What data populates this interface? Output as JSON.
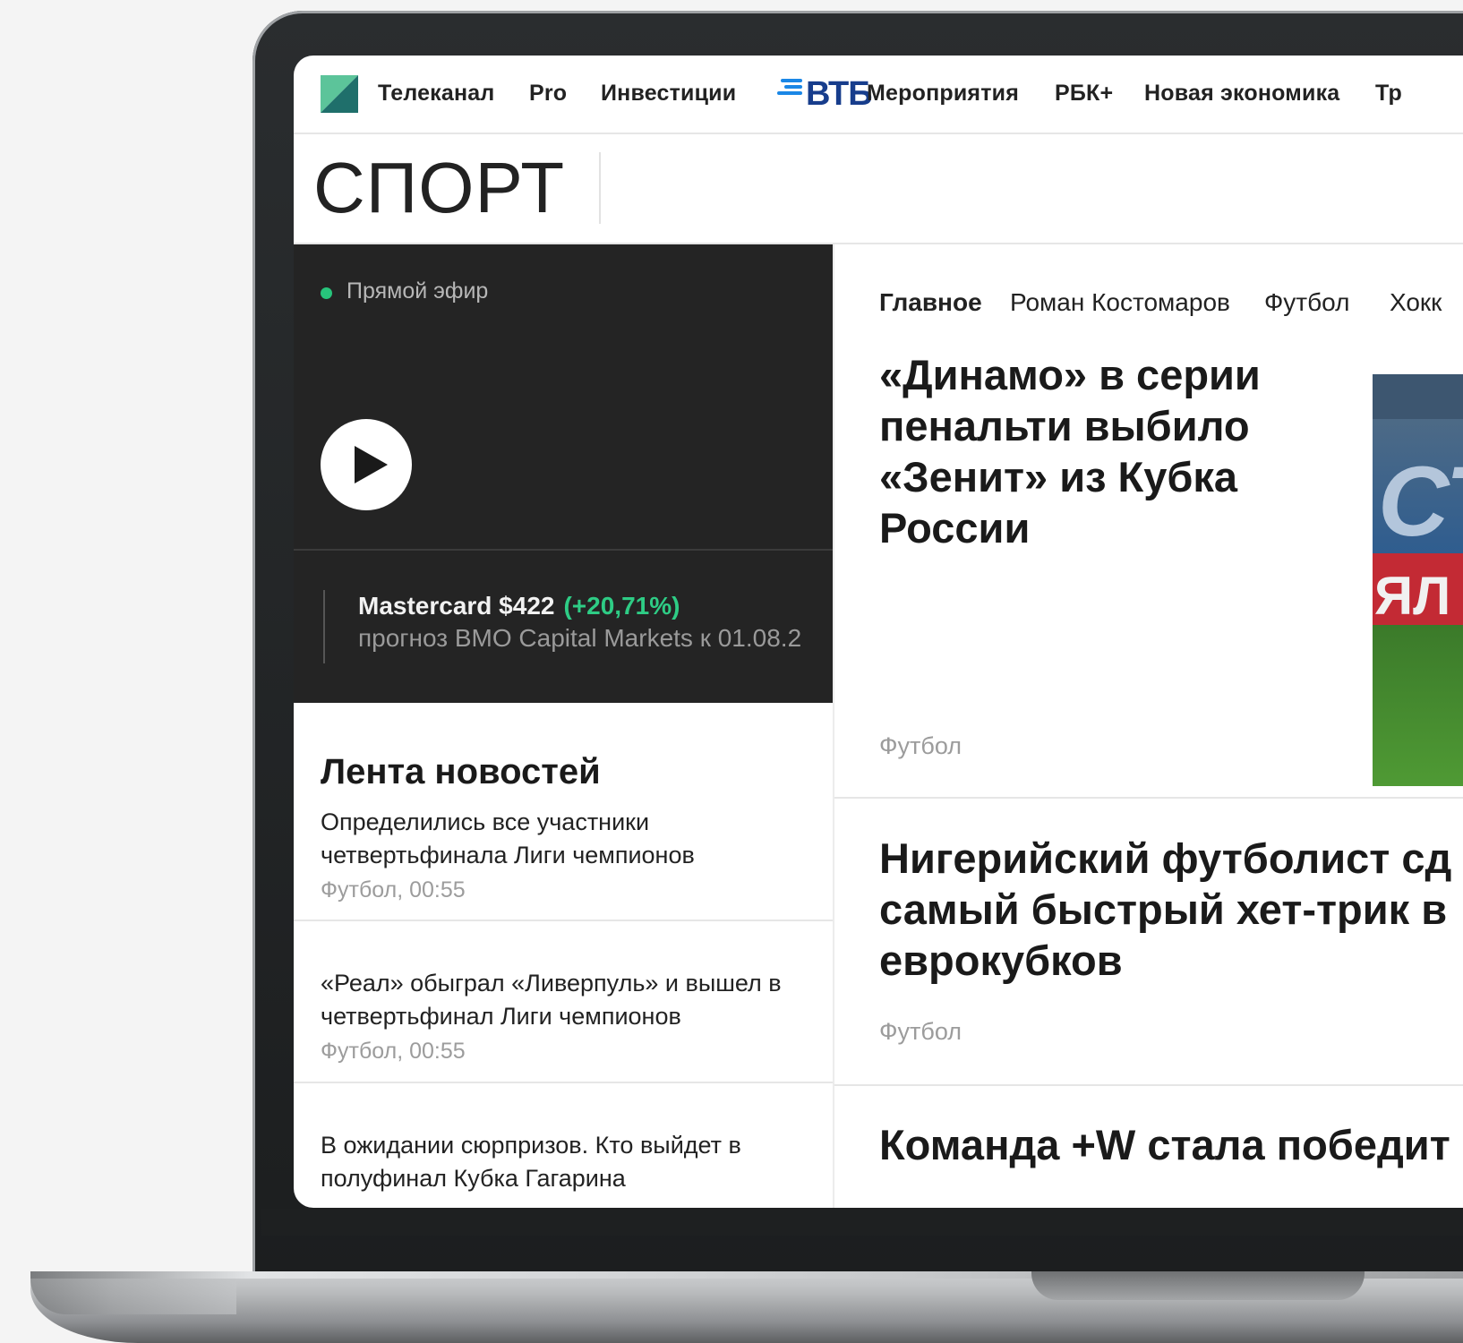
{
  "nav": {
    "items": [
      "Телеканал",
      "Pro",
      "Инвестиции",
      "Мероприятия",
      "РБК+",
      "Новая экономика",
      "Тр"
    ],
    "vtb_logo_text": "ВТБ"
  },
  "section": {
    "title": "СПОРТ"
  },
  "live": {
    "label": "Прямой эфир",
    "ticker_main": "Mastercard $422",
    "ticker_change": "(+20,71%)",
    "ticker_sub": "прогноз BMO Capital Markets к 01.08.2"
  },
  "feed": {
    "title": "Лента новостей",
    "items": [
      {
        "title": "Определились все участники четвертьфинала Лиги чемпионов",
        "meta": "Футбол, 00:55"
      },
      {
        "title": "«Реал» обыграл «Ливерпуль» и вышел в четвертьфинал Лиги чемпионов",
        "meta": "Футбол, 00:55"
      },
      {
        "title": "В ожидании сюрпризов. Кто выйдет в полуфинал Кубка Гагарина",
        "meta": ""
      }
    ]
  },
  "tabs": [
    "Главное",
    "Роман Костомаров",
    "Футбол",
    "Хокк"
  ],
  "stories": [
    {
      "title": "«Динамо» в серии пенальти выбило «Зенит» из Кубка России",
      "category": "Футбол"
    },
    {
      "title": "Нигерийский футболист сд самый быстрый хет-трик в еврокубков",
      "category": "Футбол"
    },
    {
      "title": "Команда +W стала победит",
      "category": ""
    }
  ],
  "colors": {
    "accent_green": "#27c47b",
    "change_green": "#2ecc85",
    "vtb_blue": "#173d8c",
    "dark_panel": "#242424"
  }
}
